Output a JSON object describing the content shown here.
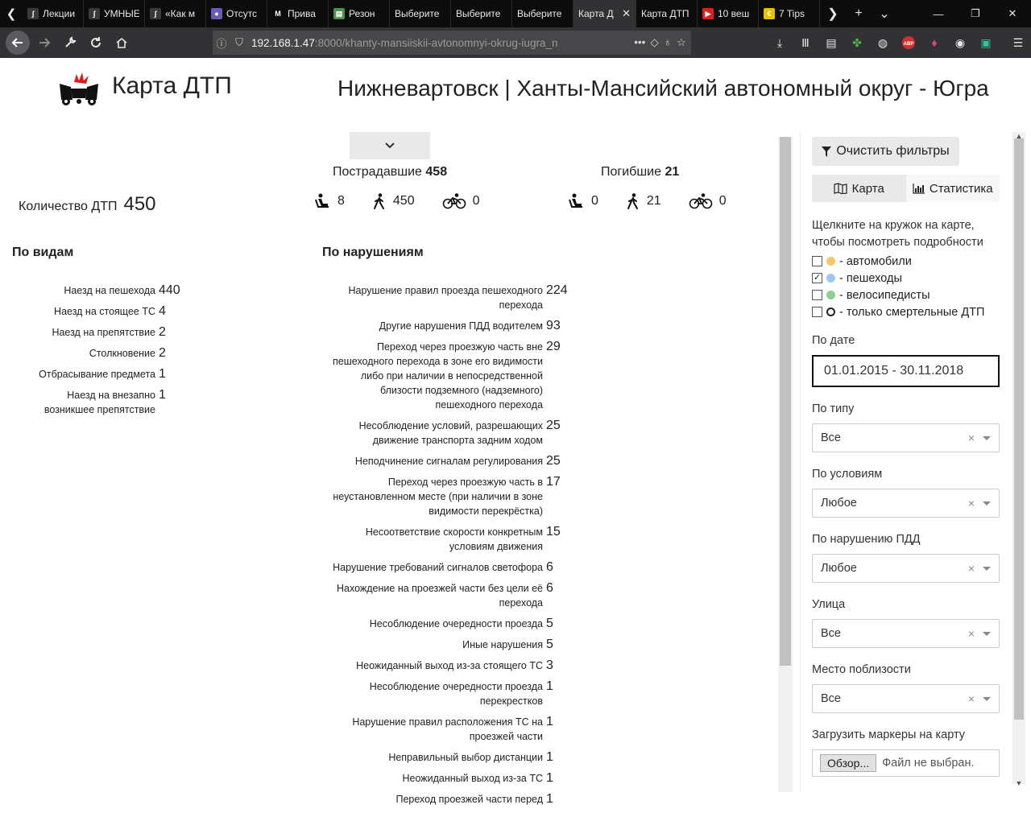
{
  "browser": {
    "tabs": [
      {
        "title": "Лекции",
        "fav_color": "#3a3a3a",
        "fav_glyph": "ʃ"
      },
      {
        "title": "УМНЫЕ",
        "fav_color": "#3a3a3a",
        "fav_glyph": "ʃ"
      },
      {
        "title": "«Как м",
        "fav_color": "#3a3a3a",
        "fav_glyph": "ʃ"
      },
      {
        "title": "Отсутс",
        "fav_color": "#6b5bb5",
        "fav_glyph": "●"
      },
      {
        "title": "Прива",
        "fav_color": "#0c0c0d",
        "fav_glyph": "M"
      },
      {
        "title": "Резон",
        "fav_color": "#4e8f4e",
        "fav_glyph": "▤"
      },
      {
        "title": "Выберите",
        "fav_color": "",
        "fav_glyph": ""
      },
      {
        "title": "Выберите",
        "fav_color": "",
        "fav_glyph": ""
      },
      {
        "title": "Выберите",
        "fav_color": "",
        "fav_glyph": ""
      },
      {
        "title": "Карта Д",
        "fav_color": "",
        "fav_glyph": "",
        "active": true
      },
      {
        "title": "Карта ДТП",
        "fav_color": "",
        "fav_glyph": ""
      },
      {
        "title": "10 веш",
        "fav_color": "#e02020",
        "fav_glyph": "▶"
      },
      {
        "title": "7 Tips",
        "fav_color": "#e6c200",
        "fav_glyph": "€"
      }
    ],
    "url_host": "192.168.1.47",
    "url_path": ":8000/khanty-mansiiskii-avtonomnyi-okrug-iugra_n"
  },
  "header": {
    "brand": "Карта ДТП",
    "region": "Нижневартовск | Ханты-Мансийский автономный округ - Югра"
  },
  "summary": {
    "total_label": "Количество ДТП",
    "total_value": "450",
    "injured_label": "Пострадавшие",
    "injured_total": "458",
    "injured": {
      "drivers": "8",
      "pedestrians": "450",
      "cyclists": "0"
    },
    "dead_label": "Погибшие",
    "dead_total": "21",
    "dead": {
      "drivers": "0",
      "pedestrians": "21",
      "cyclists": "0"
    }
  },
  "by_type": {
    "title": "По видам",
    "items": [
      {
        "name": "Наезд на пешехода",
        "count": "440"
      },
      {
        "name": "Наезд на стоящее ТС",
        "count": "4"
      },
      {
        "name": "Наезд на препятствие",
        "count": "2"
      },
      {
        "name": "Столкновение",
        "count": "2"
      },
      {
        "name": "Отбрасывание предмета",
        "count": "1"
      },
      {
        "name": "Наезд на внезапно возникшее препятствие",
        "count": "1"
      }
    ]
  },
  "by_violation": {
    "title": "По нарушениям",
    "items": [
      {
        "name": "Нарушение правил проезда пешеходного перехода",
        "count": "224"
      },
      {
        "name": "Другие нарушения ПДД водителем",
        "count": "93"
      },
      {
        "name": "Переход через проезжую часть вне пешеходного перехода в зоне его видимости либо при наличии в непосредственной близости подземного (надземного) пешеходного перехода",
        "count": "29"
      },
      {
        "name": "Несоблюдение условий, разрешающих движение транспорта задним ходом",
        "count": "25"
      },
      {
        "name": "Неподчинение сигналам регулирования",
        "count": "25"
      },
      {
        "name": "Переход через проезжую часть в неустановленном месте (при наличии в зоне видимости перекрёстка)",
        "count": "17"
      },
      {
        "name": "Несоответствие скорости конкретным условиям движения",
        "count": "15"
      },
      {
        "name": "Нарушение требований сигналов светофора",
        "count": "6"
      },
      {
        "name": "Нахождение на проезжей части без цели её перехода",
        "count": "6"
      },
      {
        "name": "Несоблюдение очередности проезда",
        "count": "5"
      },
      {
        "name": "Иные нарушения",
        "count": "5"
      },
      {
        "name": "Неожиданный выход из-за стоящего ТС",
        "count": "3"
      },
      {
        "name": "Несоблюдение очередности проезда перекрестков",
        "count": "1"
      },
      {
        "name": "Нарушение правил расположения ТС на проезжей части",
        "count": "1"
      },
      {
        "name": "Неправильный выбор дистанции",
        "count": "1"
      },
      {
        "name": "Неожиданный выход из-за ТС",
        "count": "1"
      },
      {
        "name": "Переход проезжей части перед",
        "count": "1"
      }
    ]
  },
  "filters": {
    "clear_label": "Очистить фильтры",
    "tab_map": "Карта",
    "tab_stats": "Статистика",
    "hint": "Щелкните на кружок на карте, чтобы посмотреть подробности",
    "legend": [
      {
        "label": "- автомобили",
        "color": "#f6c863",
        "checked": false
      },
      {
        "label": "- пешеходы",
        "color": "#9ec9f0",
        "checked": true
      },
      {
        "label": "- велосипедисты",
        "color": "#8fcf8f",
        "checked": false
      },
      {
        "label": "- только смертельные ДТП",
        "color": "ring",
        "checked": false
      }
    ],
    "date_label": "По дате",
    "date_value": "01.01.2015 - 30.11.2018",
    "type_label": "По типу",
    "type_value": "Все",
    "conditions_label": "По условиям",
    "conditions_value": "Любое",
    "violation_label": "По нарушению ПДД",
    "violation_value": "Любое",
    "street_label": "Улица",
    "street_value": "Все",
    "nearby_label": "Место поблизости",
    "nearby_value": "Все",
    "upload_label": "Загрузить маркеры на карту",
    "browse_label": "Обзор...",
    "no_file": "Файл не выбран."
  }
}
